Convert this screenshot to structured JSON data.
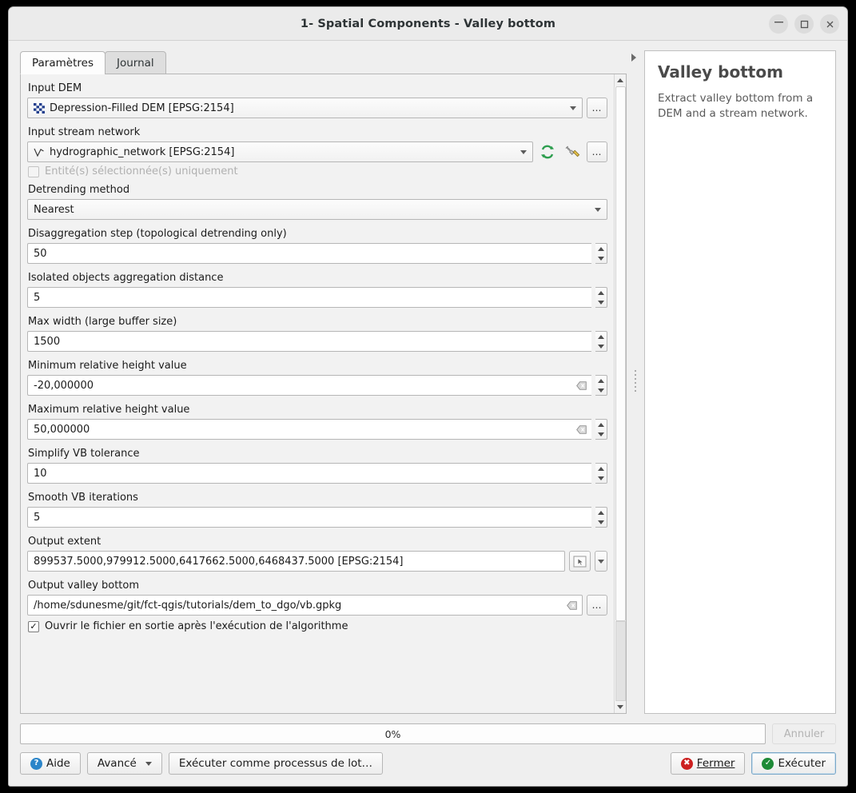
{
  "window": {
    "title": "1- Spatial Components - Valley bottom",
    "controls": {
      "minimize": "—",
      "maximize": "□",
      "close": "✕"
    }
  },
  "tabs": [
    {
      "label": "Paramètres",
      "active": true
    },
    {
      "label": "Journal",
      "active": false
    }
  ],
  "form": {
    "input_dem": {
      "label": "Input DEM",
      "value": "Depression-Filled DEM [EPSG:2154]",
      "browse": "…"
    },
    "input_stream_network": {
      "label": "Input stream network",
      "value": "hydrographic_network [EPSG:2154]",
      "browse": "…"
    },
    "selected_only": {
      "label": "Entité(s) sélectionnée(s) uniquement",
      "checked": false,
      "enabled": false
    },
    "detrending_method": {
      "label": "Detrending method",
      "value": "Nearest"
    },
    "disaggregation_step": {
      "label": "Disaggregation step (topological detrending only)",
      "value": "50"
    },
    "isolated_objects_distance": {
      "label": "Isolated objects aggregation distance",
      "value": "5"
    },
    "max_width": {
      "label": "Max width (large buffer size)",
      "value": "1500"
    },
    "min_relative_height": {
      "label": "Minimum relative height value",
      "value": "-20,000000"
    },
    "max_relative_height": {
      "label": "Maximum relative height value",
      "value": "50,000000"
    },
    "simplify_vb_tolerance": {
      "label": "Simplify VB tolerance",
      "value": "10"
    },
    "smooth_vb_iterations": {
      "label": "Smooth VB iterations",
      "value": "5"
    },
    "output_extent": {
      "label": "Output extent",
      "value": "899537.5000,979912.5000,6417662.5000,6468437.5000 [EPSG:2154]"
    },
    "output_valley_bottom": {
      "label": "Output valley bottom",
      "value": "/home/sdunesme/git/fct-qgis/tutorials/dem_to_dgo/vb.gpkg",
      "browse": "…"
    },
    "open_output": {
      "label": "Ouvrir le fichier en sortie après l'exécution de l'algorithme",
      "checked": true,
      "mark": "✓"
    }
  },
  "help": {
    "title": "Valley bottom",
    "description": "Extract valley bottom from a DEM and a stream network."
  },
  "footer": {
    "progress_text": "0%",
    "progress_value": 0,
    "cancel_label": "Annuler",
    "help_label": "Aide",
    "advanced_label": "Avancé",
    "batch_label": "Exécuter comme processus de lot…",
    "close_label": "Fermer",
    "run_label": "Exécuter"
  },
  "colors": {
    "titlebar": "#ebebeb",
    "window_bg": "#efefef",
    "accent_green": "#1e8a37",
    "accent_red": "#cc1f1f",
    "accent_blue": "#2b85c9",
    "help_title": "#4a4a4a"
  }
}
